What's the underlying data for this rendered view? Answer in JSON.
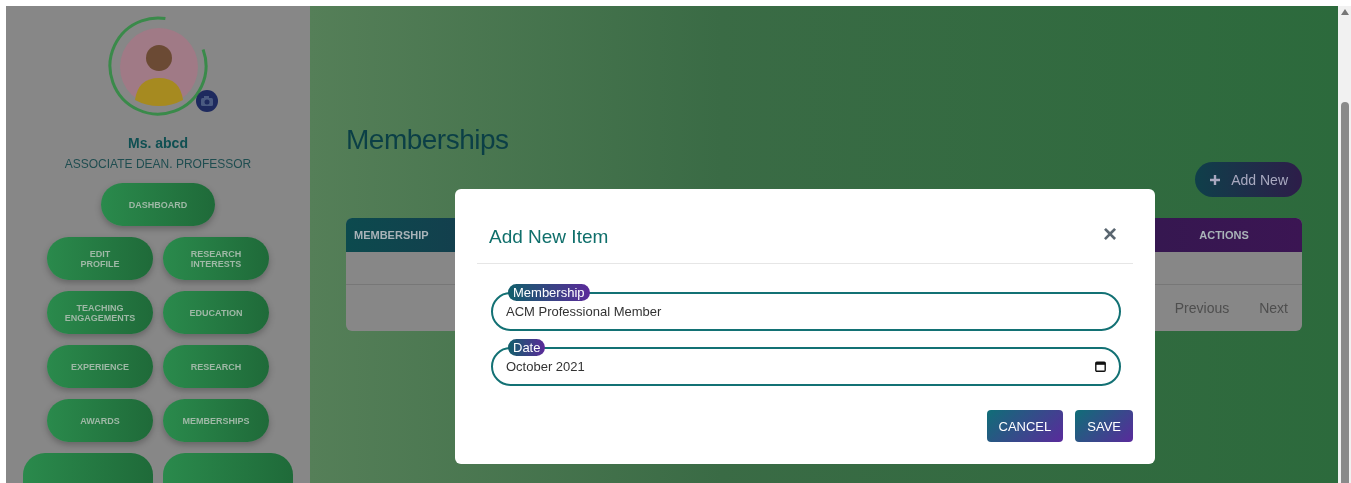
{
  "sidebar": {
    "profile": {
      "name": "Ms. abcd",
      "role": "ASSOCIATE DEAN. PROFESSOR"
    },
    "nav_rows": [
      [
        {
          "label": "DASHBOARD"
        }
      ],
      [
        {
          "label": "EDIT\nPROFILE"
        },
        {
          "label": "RESEARCH\nINTERESTS"
        }
      ],
      [
        {
          "label": "TEACHING\nENGAGEMENTS"
        },
        {
          "label": "EDUCATION"
        }
      ],
      [
        {
          "label": "EXPERIENCE"
        },
        {
          "label": "RESEARCH"
        }
      ],
      [
        {
          "label": "AWARDS"
        },
        {
          "label": "MEMBERSHIPS"
        }
      ]
    ]
  },
  "main": {
    "title": "Memberships",
    "add_button": "Add New",
    "table": {
      "columns": [
        "MEMBERSHIP",
        "ACTIONS"
      ],
      "pagination": [
        "Previous",
        "Next"
      ]
    }
  },
  "modal": {
    "title": "Add New Item",
    "close": "×",
    "fields": [
      {
        "kind": "text",
        "label": "Membership",
        "value": "ACM Professional Member"
      },
      {
        "kind": "date",
        "label": "Date",
        "value": "October 2021"
      }
    ],
    "buttons": [
      "CANCEL",
      "SAVE"
    ]
  }
}
